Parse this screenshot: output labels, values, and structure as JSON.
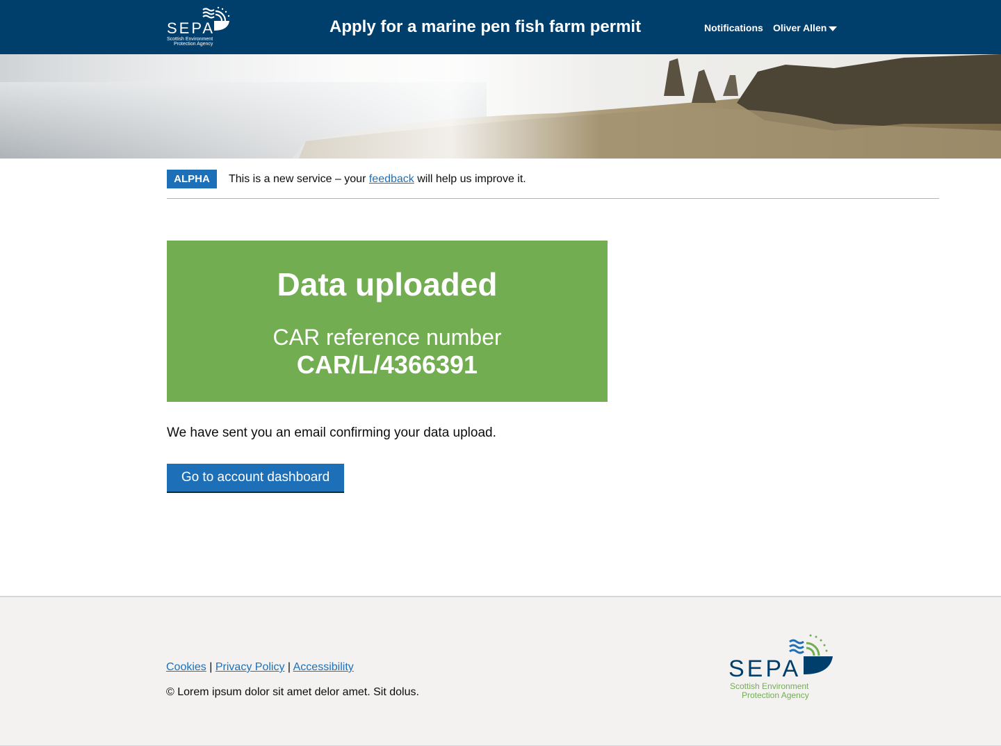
{
  "header": {
    "logo_text": "SEPA",
    "logo_subtitle_1": "Scottish Environment",
    "logo_subtitle_2": "Protection Agency",
    "title": "Apply for a marine pen fish farm permit",
    "nav": {
      "notifications": "Notifications",
      "user": "Oliver Allen"
    },
    "background_color": "#003e6b"
  },
  "phase_banner": {
    "tag": "ALPHA",
    "text_before": "This is a new service – your ",
    "link": "feedback",
    "text_after": " will help us improve it."
  },
  "panel": {
    "title": "Data uploaded",
    "label": "CAR reference number",
    "reference": "CAR/L/4366391",
    "color": "#72ad52"
  },
  "confirmation_text": "We have sent you an email confirming your data upload.",
  "primary_button": "Go to account dashboard",
  "footer": {
    "links": [
      "Cookies",
      "Privacy Policy",
      "Accessibility"
    ],
    "separator": "|",
    "copyright": "© Lorem ipsum dolor sit amet delor amet. Sit dolus.",
    "logo_text": "SEPA",
    "logo_subtitle_1": "Scottish Environment",
    "logo_subtitle_2": "Protection Agency"
  },
  "colors": {
    "link": "#1d70b8",
    "footer_bg": "#f3f2f1"
  }
}
